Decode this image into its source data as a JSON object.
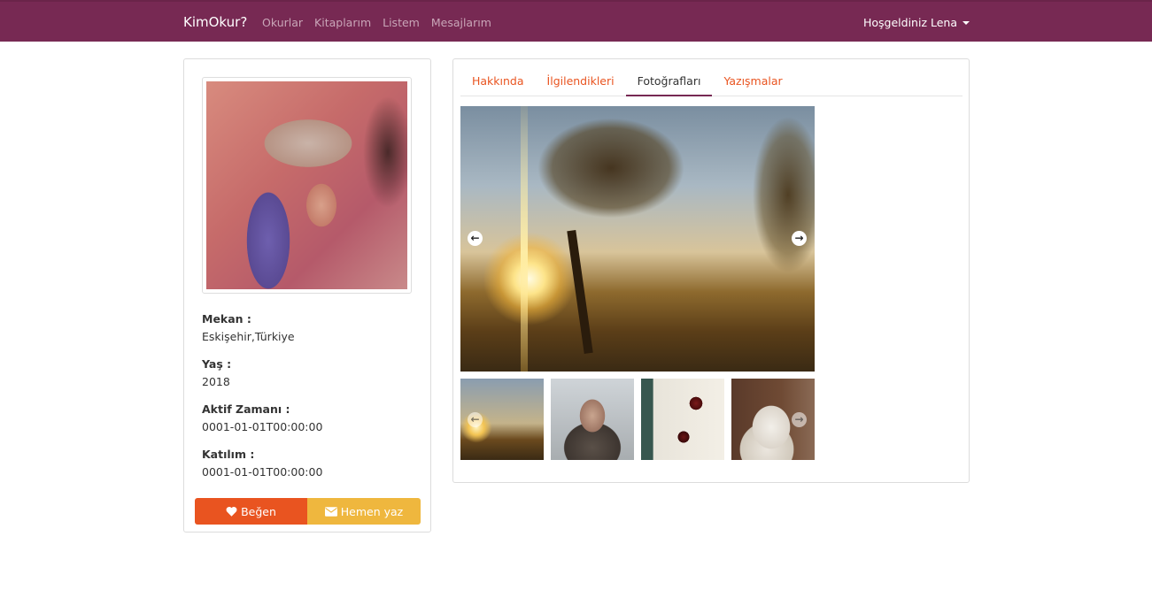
{
  "navbar": {
    "brand": "KimOkur?",
    "links": [
      "Okurlar",
      "Kitaplarım",
      "Listem",
      "Mesajlarım"
    ],
    "user_menu": "Hoşgeldiniz Lena",
    "colors": {
      "bar": "#772953",
      "link": "#c9a6b8"
    }
  },
  "profile": {
    "fields": [
      {
        "label": "Mekan :",
        "value": "Eskişehir,Türkiye"
      },
      {
        "label": "Yaş :",
        "value": "2018"
      },
      {
        "label": "Aktif Zamanı :",
        "value": "0001-01-01T00:00:00"
      },
      {
        "label": "Katılım :",
        "value": "0001-01-01T00:00:00"
      }
    ],
    "buttons": {
      "like": {
        "label": "Beğen",
        "icon": "heart-icon",
        "color": "#e95420"
      },
      "write": {
        "label": "Hemen yaz",
        "icon": "envelope-icon",
        "color": "#efb73e"
      }
    }
  },
  "tabs": {
    "items": [
      "Hakkında",
      "İlgilendikleri",
      "Fotoğrafları",
      "Yazışmalar"
    ],
    "active": "Fotoğrafları",
    "colors": {
      "link": "#e95420",
      "active_underline": "#772953"
    }
  },
  "gallery": {
    "controls": {
      "prev_icon": "arrow-left-circle-icon",
      "next_icon": "arrow-right-circle-icon",
      "prev_glyph": "←",
      "next_glyph": "→"
    },
    "thumbnails": [
      "sunset-tree-thumb",
      "man-in-snow-thumb",
      "roses-thumb",
      "white-cat-thumb"
    ]
  }
}
